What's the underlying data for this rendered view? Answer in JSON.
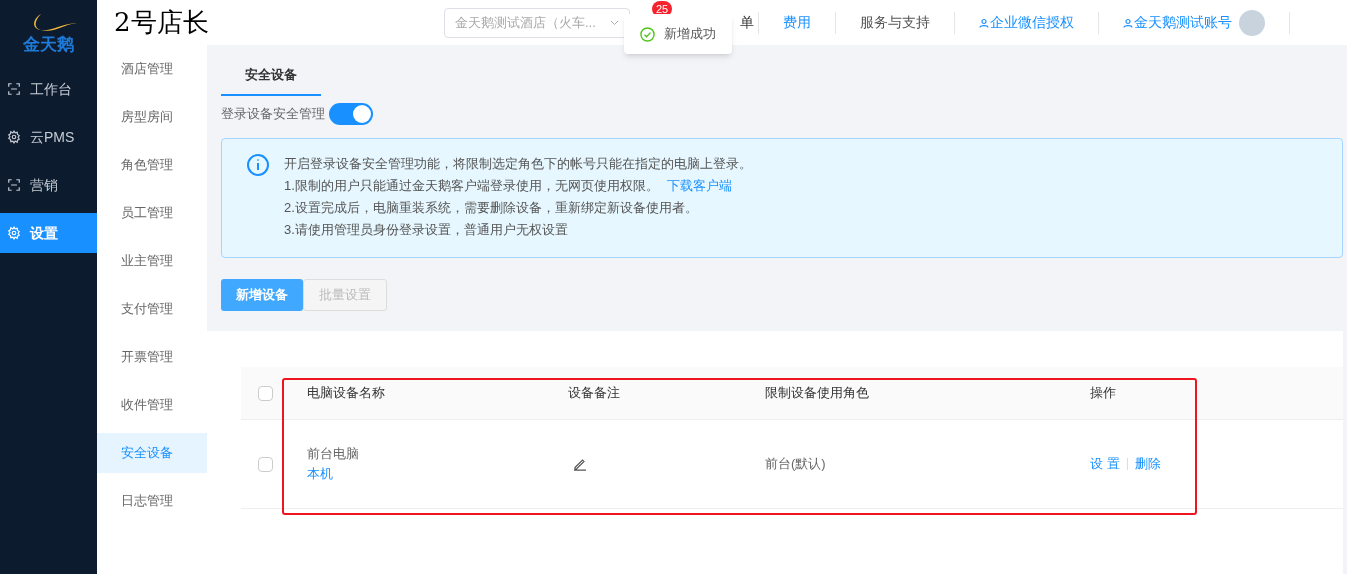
{
  "logo": {
    "text": "金天鹅"
  },
  "nav": [
    {
      "label": "工作台",
      "kind": "frame",
      "selected": false
    },
    {
      "label": "云PMS",
      "kind": "gear",
      "selected": false
    },
    {
      "label": "营销",
      "kind": "frame",
      "selected": false
    },
    {
      "label": "设置",
      "kind": "gear",
      "selected": true
    }
  ],
  "header": {
    "title": "2号店长",
    "hotel_select": "金天鹅测试酒店（火车...",
    "badge": "25",
    "partial_item": "单",
    "links": [
      {
        "label": "费用",
        "kind": "link"
      },
      {
        "label": "服务与支持",
        "kind": "plain"
      },
      {
        "label": "企业微信授权",
        "kind": "user"
      },
      {
        "label": "金天鹅测试账号",
        "kind": "user"
      }
    ]
  },
  "toast": {
    "text": "新增成功"
  },
  "submenu": [
    {
      "label": "酒店管理",
      "selected": false
    },
    {
      "label": "房型房间",
      "selected": false
    },
    {
      "label": "角色管理",
      "selected": false
    },
    {
      "label": "员工管理",
      "selected": false
    },
    {
      "label": "业主管理",
      "selected": false
    },
    {
      "label": "支付管理",
      "selected": false
    },
    {
      "label": "开票管理",
      "selected": false
    },
    {
      "label": "收件管理",
      "selected": false
    },
    {
      "label": "安全设备",
      "selected": true
    },
    {
      "label": "日志管理",
      "selected": false
    }
  ],
  "tabs": [
    {
      "label": "安全设备",
      "selected": true
    }
  ],
  "switch": {
    "label": "登录设备安全管理",
    "on": true
  },
  "notice": {
    "lines": [
      "开启登录设备安全管理功能，将限制选定角色下的帐号只能在指定的电脑上登录。",
      "1.限制的用户只能通过金天鹅客户端登录使用，无网页使用权限。",
      "2.设置完成后，电脑重装系统，需要删除设备，重新绑定新设备使用者。",
      "3.请使用管理员身份登录设置，普通用户无权设置"
    ],
    "link": "下载客户端"
  },
  "buttons": [
    {
      "label": "新增设备",
      "disabled": false
    },
    {
      "label": "批量设置",
      "disabled": true
    }
  ],
  "table": {
    "all_checked": false,
    "columns": [
      "电脑设备名称",
      "设备备注",
      "限制设备使用角色",
      "操作"
    ],
    "rows": [
      {
        "checked": false,
        "name": "前台电脑",
        "tag": "本机",
        "role": "前台(默认)",
        "actions": [
          "设 置",
          "删除"
        ]
      }
    ]
  }
}
